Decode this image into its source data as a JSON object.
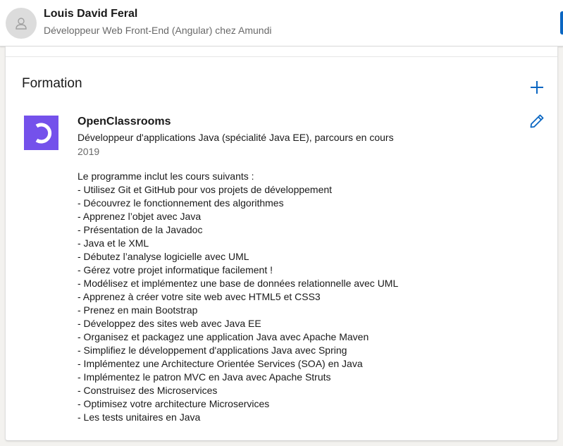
{
  "header": {
    "name": "Louis David Feral",
    "headline": "Développeur Web Front-End (Angular) chez Amundi"
  },
  "section": {
    "title": "Formation",
    "add_icon": "plus-icon",
    "edit_icon": "pencil-icon"
  },
  "education": {
    "school": "OpenClassrooms",
    "degree": "Développeur d'applications Java (spécialité Java EE), parcours en cours",
    "dates": "2019",
    "logo_color": "#7451eb",
    "description": [
      "Le programme inclut les cours suivants :",
      "- Utilisez Git et GitHub pour vos projets de développement",
      "- Découvrez le fonctionnement des algorithmes",
      "- Apprenez l’objet avec Java",
      "- Présentation de la Javadoc",
      "- Java et le XML",
      "- Débutez l’analyse logicielle avec UML",
      "- Gérez votre projet informatique facilement !",
      "- Modélisez et implémentez une base de données relationnelle avec UML",
      "- Apprenez à créer votre site web avec HTML5 et CSS3",
      "- Prenez en main Bootstrap",
      "- Développez des sites web avec Java EE",
      "- Organisez et packagez une application Java avec Apache Maven",
      "- Simplifiez le développement d'applications Java avec Spring",
      "- Implémentez une Architecture Orientée Services (SOA) en Java",
      "- Implémentez le patron MVC en Java avec Apache Struts",
      "- Construisez des Microservices",
      "- Optimisez votre architecture Microservices",
      "- Les tests unitaires en Java"
    ]
  },
  "colors": {
    "accent": "#0a66c2",
    "page_background": "#f3f2ef"
  }
}
